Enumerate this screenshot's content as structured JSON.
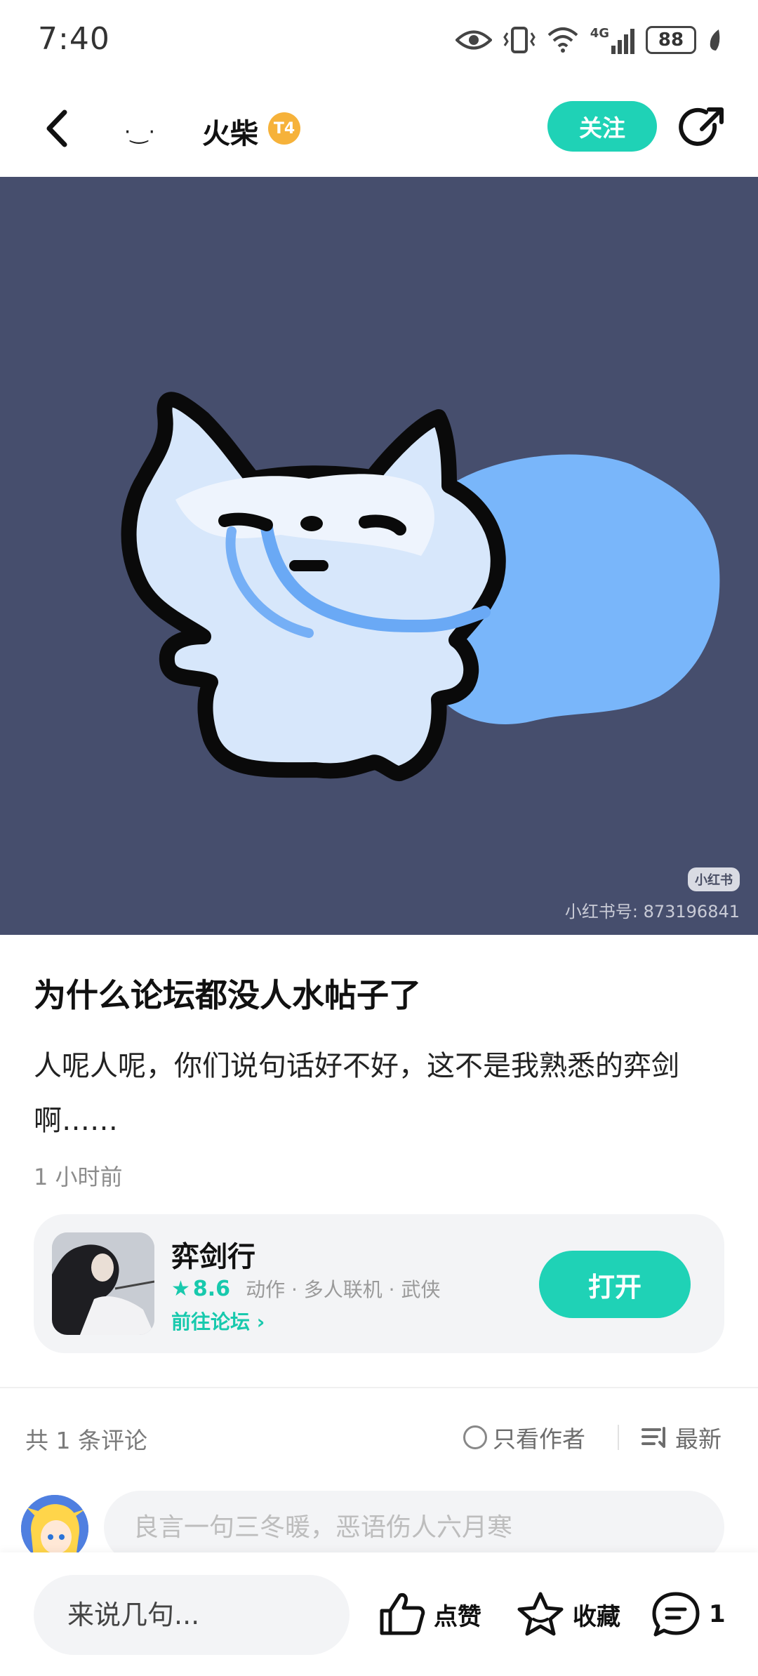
{
  "status": {
    "time": "7:40",
    "network": "4G",
    "battery": "88"
  },
  "nav": {
    "avatar_face": "· ͜ ·",
    "author_name": "火柴",
    "level_badge": "T4",
    "follow_label": "关注"
  },
  "hero": {
    "logo_text": "小红书",
    "watermark": "小红书号: 873196841",
    "background": "#464e6d"
  },
  "post": {
    "title": "为什么论坛都没人水帖子了",
    "body": "人呢人呢，你们说句话好不好，这不是我熟悉的弈剑啊……",
    "time": "1 小时前"
  },
  "game": {
    "name": "弈剑行",
    "rating": "8.6",
    "tags": "动作 · 多人联机 · 武侠",
    "forum_link": "前往论坛 ›",
    "open_label": "打开"
  },
  "comments": {
    "count_label": "共 1 条评论",
    "only_author_label": "只看作者",
    "sort_label": "最新",
    "input_placeholder": "良言一句三冬暖，恶语伤人六月寒"
  },
  "bottom_bar": {
    "say_placeholder": "来说几句...",
    "like_label": "点赞",
    "fav_label": "收藏",
    "comment_count": "1"
  },
  "colors": {
    "accent": "#1fd2b6",
    "hero_bg": "#464e6d"
  }
}
